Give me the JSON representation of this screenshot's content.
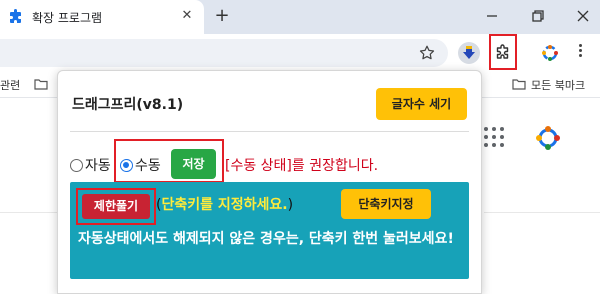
{
  "browser": {
    "tab_title": "확장 프로그램",
    "new_tab_label": "+",
    "close_label": "✕",
    "bookmarks": {
      "left_label": "관련",
      "right_label": "모든 북마크"
    }
  },
  "popup": {
    "title": "드래그프리(v8.1)",
    "wordcount_button": "글자수 세기",
    "mode": {
      "auto_label": "자동",
      "manual_label": "수동",
      "selected": "manual",
      "save_button": "저장",
      "manual_hint": "[수동 상태]를 권장합니다."
    },
    "info": {
      "release_button": "제한풀기",
      "paren_open": "(",
      "shortcut_hint": "단축키를 지정하세요.",
      "paren_close": ")",
      "shortcut_button": "단축키지정",
      "body_text": "자동상태에서도 해제되지 않은 경우는, 단축키 한번 눌러보세요!"
    }
  },
  "colors": {
    "accent_yellow": "#ffc107",
    "save_green": "#28a745",
    "release_red": "#c82333",
    "info_teal": "#17a2b8",
    "hint_red": "#d0021b",
    "highlight_red": "#e21f26"
  },
  "icons": [
    "puzzle-tab-icon",
    "star-icon",
    "download-extension-icon",
    "puzzle-extension-icon",
    "colorful-extension-icon",
    "kebab-menu-icon",
    "folder-icon",
    "apps-grid-icon"
  ]
}
